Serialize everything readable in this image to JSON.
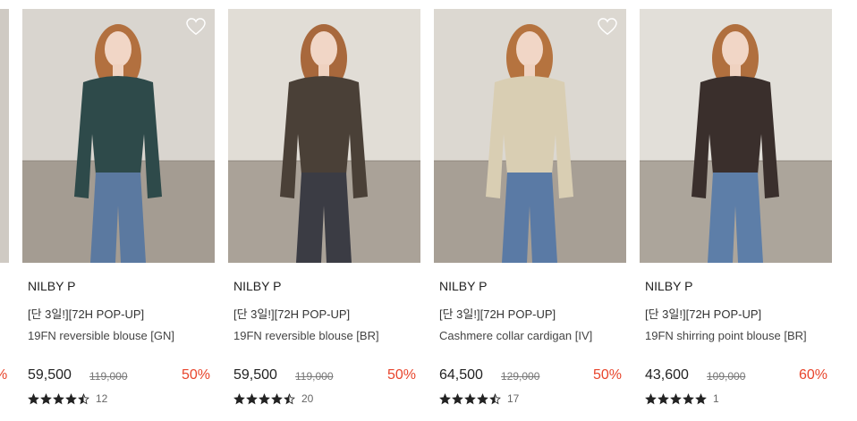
{
  "left_partial_card": {
    "discount": "%"
  },
  "products": [
    {
      "brand": "NILBY P",
      "tag": "[단 3일!][72H POP-UP]",
      "name": "19FN reversible blouse [GN]",
      "price": "59,500",
      "original_price": "119,000",
      "discount": "50%",
      "rating_stars": 4.5,
      "review_count": "12",
      "wishlist_icon": true,
      "colors": {
        "wall": "#d9d5cf",
        "floor": "#a49c92",
        "top": "#2e4a4a",
        "bottom": "#5b79a0",
        "hair": "#b2703f"
      }
    },
    {
      "brand": "NILBY P",
      "tag": "[단 3일!][72H POP-UP]",
      "name": "19FN reversible blouse [BR]",
      "price": "59,500",
      "original_price": "119,000",
      "discount": "50%",
      "rating_stars": 4.5,
      "review_count": "20",
      "wishlist_icon": false,
      "colors": {
        "wall": "#e1ddd6",
        "floor": "#aaa298",
        "top": "#4a4037",
        "bottom": "#3b3c44",
        "hair": "#a8683c"
      }
    },
    {
      "brand": "NILBY P",
      "tag": "[단 3일!][72H POP-UP]",
      "name": "Cashmere collar cardigan [IV]",
      "price": "64,500",
      "original_price": "129,000",
      "discount": "50%",
      "rating_stars": 4.5,
      "review_count": "17",
      "wishlist_icon": true,
      "colors": {
        "wall": "#dcd8d1",
        "floor": "#a79f95",
        "top": "#d9ceb3",
        "bottom": "#5a7aa5",
        "hair": "#b5733f"
      }
    },
    {
      "brand": "NILBY P",
      "tag": "[단 3일!][72H POP-UP]",
      "name": "19FN shirring point blouse [BR]",
      "price": "43,600",
      "original_price": "109,000",
      "discount": "60%",
      "rating_stars": 5,
      "review_count": "1",
      "wishlist_icon": false,
      "colors": {
        "wall": "#e2dfd9",
        "floor": "#aca59b",
        "top": "#3a2f2c",
        "bottom": "#5d7ea8",
        "hair": "#b06f3e"
      }
    }
  ]
}
